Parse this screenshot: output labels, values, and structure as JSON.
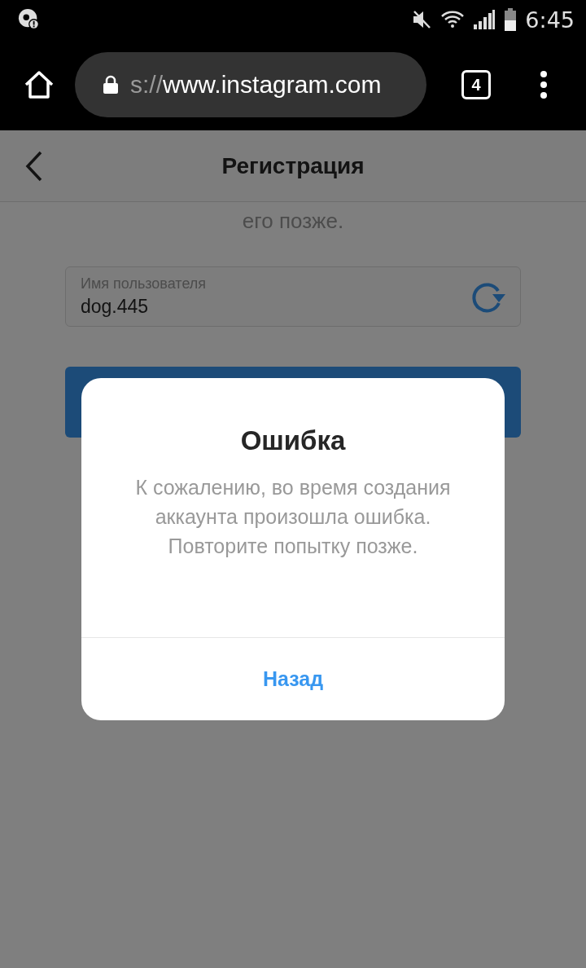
{
  "status_bar": {
    "time": "6:45"
  },
  "browser": {
    "url_scheme": "s://",
    "url_host": "www.instagram.com",
    "tab_count": "4"
  },
  "header": {
    "title": "Регистрация"
  },
  "intro_text": "его позже.",
  "username_field": {
    "label": "Имя пользователя",
    "value": "dog.445"
  },
  "dialog": {
    "title": "Ошибка",
    "message": "К сожалению, во время создания аккаунта произошла ошибка. Повторите попытку позже.",
    "button": "Назад"
  }
}
